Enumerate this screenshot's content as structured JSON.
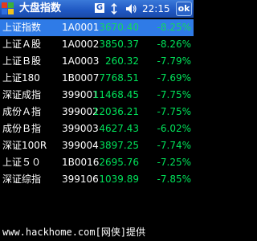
{
  "titlebar": {
    "title": "大盘指数",
    "net_badge": "G",
    "time": "22:15",
    "ok_label": "ok"
  },
  "rows": [
    {
      "name": "上证指数",
      "code": "1A0001",
      "price": "3670.40",
      "change": "-8.25%"
    },
    {
      "name": "上证Ａ股",
      "code": "1A0002",
      "price": "3850.37",
      "change": "-8.26%"
    },
    {
      "name": "上证Ｂ股",
      "code": "1A0003",
      "price": "260.32",
      "change": "-7.79%"
    },
    {
      "name": "上证180",
      "code": "1B0007",
      "price": "7768.51",
      "change": "-7.69%"
    },
    {
      "name": "深证成指",
      "code": "399001",
      "price": "11468.45",
      "change": "-7.75%"
    },
    {
      "name": "成份Ａ指",
      "code": "399002",
      "price": "12036.21",
      "change": "-7.75%"
    },
    {
      "name": "成份Ｂ指",
      "code": "399003",
      "price": "4627.43",
      "change": "-6.02%"
    },
    {
      "name": "深证100R",
      "code": "399004",
      "price": "3897.25",
      "change": "-7.74%"
    },
    {
      "name": "上证５０",
      "code": "1B0016",
      "price": "2695.76",
      "change": "-7.25%"
    },
    {
      "name": "深证综指",
      "code": "399106",
      "price": "1039.89",
      "change": "-7.85%"
    }
  ],
  "footer": {
    "watermark": "www.hackhome.com[网侠]提供"
  },
  "colors": {
    "title_bar": "#1f57c2",
    "selected_row": "#2f7be7",
    "value_green": "#00e35a"
  }
}
